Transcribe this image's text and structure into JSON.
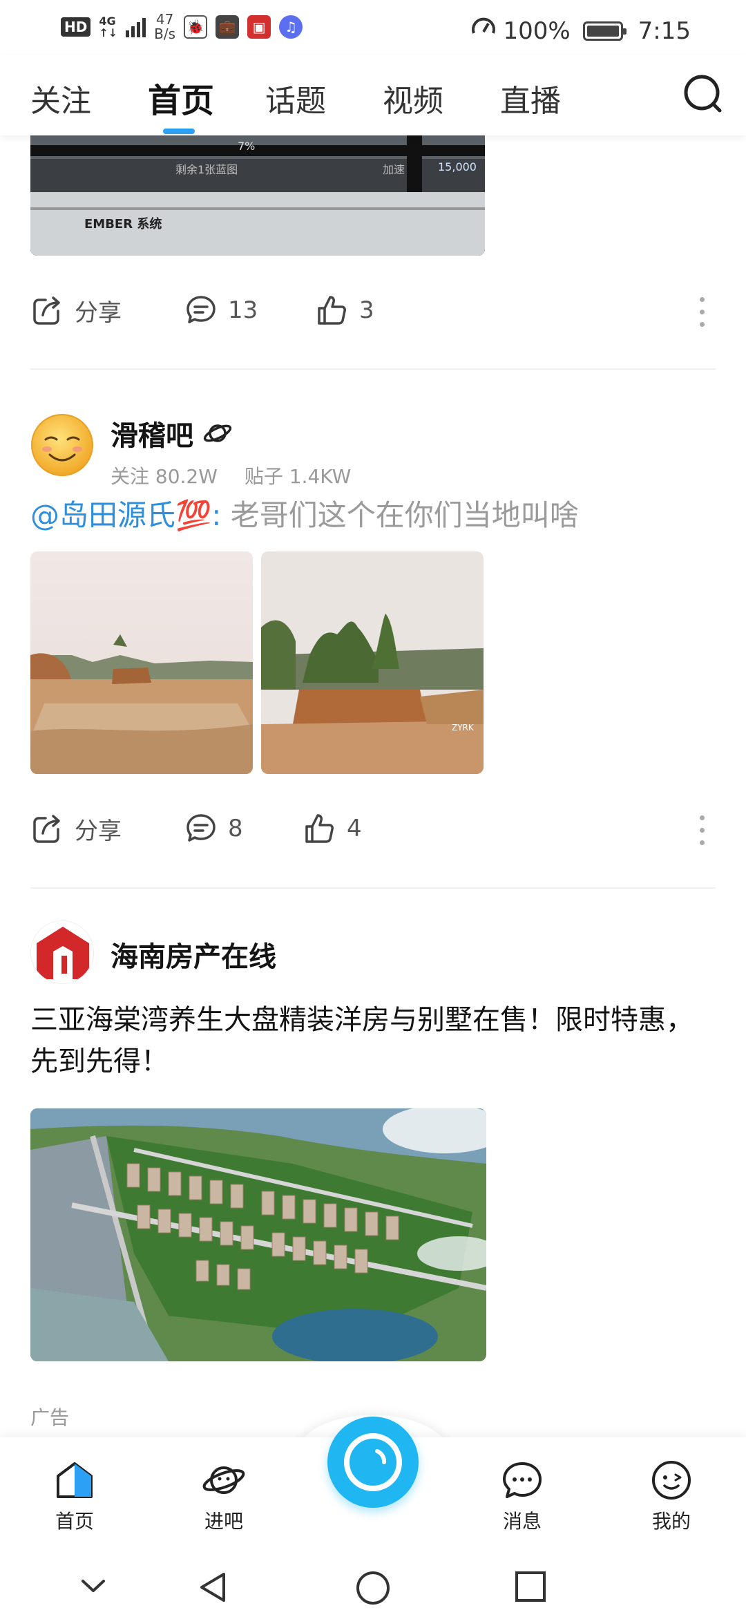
{
  "status_bar": {
    "hd": "HD",
    "network": "4G",
    "speed_value": "47",
    "speed_unit": "B/s",
    "battery_level": "100%",
    "battery_fraction": 1.0,
    "time": "7:15"
  },
  "top_tabs": {
    "items": [
      "关注",
      "首页",
      "话题",
      "视频",
      "直播"
    ],
    "active_index": 1,
    "accent_color": "#2ba0f4"
  },
  "post1": {
    "image_overlay": {
      "percent": "7%",
      "remaining": "剩余1张蓝图",
      "speed_up": "加速",
      "coins": "15,000",
      "system_label": "EMBER 系统"
    },
    "actions": {
      "share": "分享",
      "comments": "13",
      "likes": "3"
    }
  },
  "post2": {
    "author": "滑稽吧",
    "followers": "关注 80.2W",
    "posts": "贴子 1.4KW",
    "mention": "@岛田源氏💯",
    "separator": ":",
    "text": " 老哥们这个在你们当地叫啥",
    "image_watermark": "ZYRK",
    "actions": {
      "share": "分享",
      "comments": "8",
      "likes": "4"
    }
  },
  "post3": {
    "author": "海南房产在线",
    "text": "三亚海棠湾养生大盘精装洋房与别墅在售！限时特惠，先到先得！",
    "ad_label": "广告"
  },
  "bottom_nav": {
    "items": [
      "首页",
      "进吧",
      "消息",
      "我的"
    ],
    "center_color": "#1fb6f2"
  }
}
